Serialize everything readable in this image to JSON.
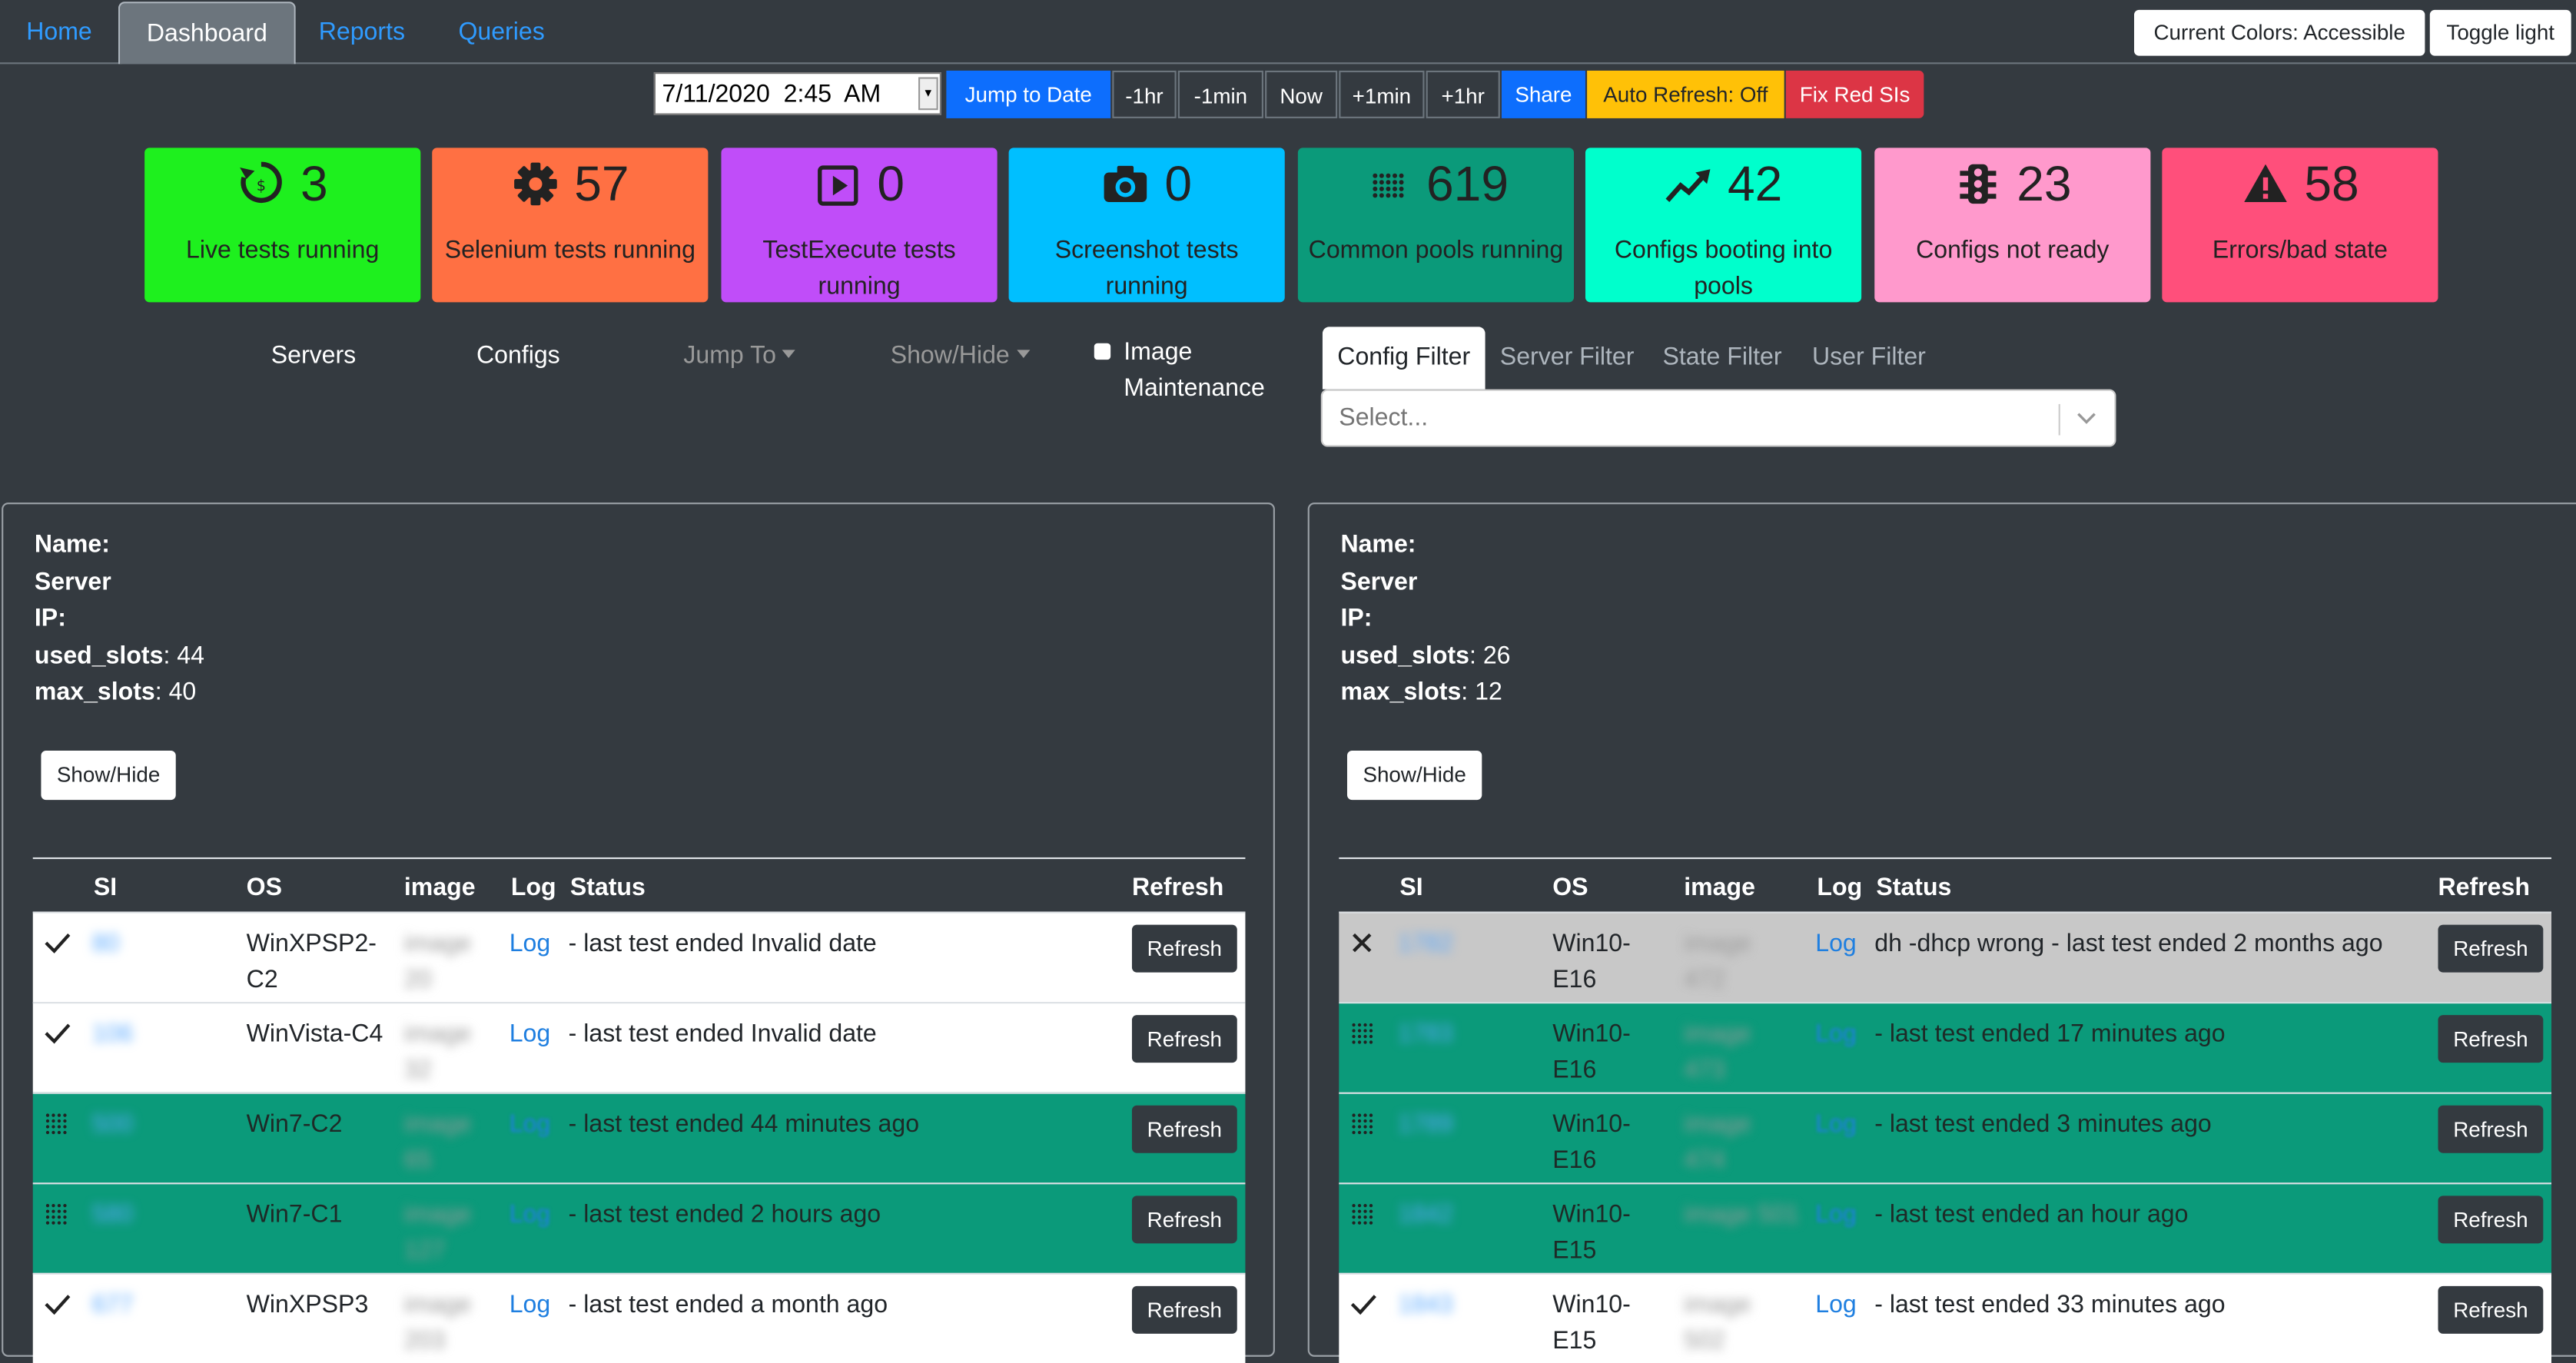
{
  "nav": {
    "home": "Home",
    "dashboard": "Dashboard",
    "reports": "Reports",
    "queries": "Queries",
    "colors_button": "Current Colors: Accessible",
    "toggle_button": "Toggle light"
  },
  "toolbar": {
    "datetime": "7/11/2020  2:45  AM",
    "jump": "Jump to Date",
    "minus_hr": "-1hr",
    "minus_min": "-1min",
    "now": "Now",
    "plus_min": "+1min",
    "plus_hr": "+1hr",
    "share": "Share",
    "auto_refresh": "Auto Refresh: Off",
    "fix_red": "Fix Red SIs"
  },
  "cards": [
    {
      "value": "3",
      "label": "Live tests running",
      "color": "#1ef01e",
      "icon": "live-refresh-icon"
    },
    {
      "value": "57",
      "label": "Selenium tests running",
      "color": "#ff7043",
      "icon": "gear-icon"
    },
    {
      "value": "0",
      "label": "TestExecute tests running",
      "color": "#c04df9",
      "icon": "play-icon"
    },
    {
      "value": "0",
      "label": "Screenshot tests running",
      "color": "#00bfff",
      "icon": "camera-icon"
    },
    {
      "value": "619",
      "label": "Common pools running",
      "color": "#0b9a7a",
      "icon": "dots-grid-icon"
    },
    {
      "value": "42",
      "label": "Configs booting into pools",
      "color": "#00ffcc",
      "icon": "trend-up-icon"
    },
    {
      "value": "23",
      "label": "Configs not ready",
      "color": "#ff99cc",
      "icon": "traffic-light-icon"
    },
    {
      "value": "58",
      "label": "Errors/bad state",
      "color": "#ff4f7b",
      "icon": "warning-icon"
    }
  ],
  "subnav": {
    "servers": "Servers",
    "configs": "Configs",
    "jump_to": "Jump To",
    "show_hide": "Show/Hide",
    "image_maint_1": "Image",
    "image_maint_2": "Maintenance"
  },
  "filters": {
    "config": "Config Filter",
    "server": "Server Filter",
    "state": "State Filter",
    "user": "User Filter",
    "placeholder": "Select..."
  },
  "table_headers": {
    "si": "SI",
    "os": "OS",
    "image": "image",
    "log": "Log",
    "status": "Status",
    "refresh": "Refresh"
  },
  "panels": [
    {
      "name_label": "Name:",
      "server_label": "Server",
      "ip_label": "IP:",
      "used_slots_label": "used_slots",
      "used_slots": ": 44",
      "max_slots_label": "max_slots",
      "max_slots": ": 40",
      "show_hide": "Show/Hide",
      "rows": [
        {
          "state": "check",
          "bg": "white",
          "si": "80",
          "os1": "WinXPSP2-",
          "os2": "C2",
          "img1": "image",
          "img2": "20",
          "log": "Log",
          "status": "- last test ended Invalid date",
          "refresh": "Refresh"
        },
        {
          "state": "check",
          "bg": "white",
          "si": "106",
          "os1": "WinVista-C4",
          "os2": "",
          "img1": "image",
          "img2": "32",
          "log": "Log",
          "status": "- last test ended Invalid date",
          "refresh": "Refresh"
        },
        {
          "state": "pool",
          "bg": "green",
          "si": "500",
          "os1": "Win7-C2",
          "os2": "",
          "img1": "image",
          "img2": "65",
          "log": "Log",
          "status": "- last test ended 44 minutes ago",
          "refresh": "Refresh"
        },
        {
          "state": "pool",
          "bg": "green",
          "si": "580",
          "os1": "Win7-C1",
          "os2": "",
          "img1": "image",
          "img2": "127",
          "log": "Log",
          "status": "- last test ended 2 hours ago",
          "refresh": "Refresh"
        },
        {
          "state": "check",
          "bg": "white",
          "si": "677",
          "os1": "WinXPSP3",
          "os2": "",
          "img1": "image",
          "img2": "203",
          "log": "Log",
          "status": "- last test ended a month ago",
          "refresh": "Refresh"
        }
      ]
    },
    {
      "name_label": "Name:",
      "server_label": "Server",
      "ip_label": "IP:",
      "used_slots_label": "used_slots",
      "used_slots": ": 26",
      "max_slots_label": "max_slots",
      "max_slots": ": 12",
      "show_hide": "Show/Hide",
      "rows": [
        {
          "state": "cross",
          "bg": "gray",
          "si": "1782",
          "os1": "Win10-",
          "os2": "E16",
          "img1": "image",
          "img2": "472",
          "log": "Log",
          "status": "dh -dhcp wrong - last test ended 2 months ago",
          "refresh": "Refresh"
        },
        {
          "state": "pool",
          "bg": "green",
          "si": "1783",
          "os1": "Win10-",
          "os2": "E16",
          "img1": "image",
          "img2": "473",
          "log": "Log",
          "status": "- last test ended 17 minutes ago",
          "refresh": "Refresh"
        },
        {
          "state": "pool",
          "bg": "green",
          "si": "1789",
          "os1": "Win10-",
          "os2": "E16",
          "img1": "image",
          "img2": "474",
          "log": "Log",
          "status": "- last test ended 3 minutes ago",
          "refresh": "Refresh"
        },
        {
          "state": "pool",
          "bg": "green",
          "si": "1842",
          "os1": "Win10-",
          "os2": "E15",
          "img1": "image 501",
          "img2": "",
          "log": "Log",
          "status": "- last test ended an hour ago",
          "refresh": "Refresh"
        },
        {
          "state": "check",
          "bg": "white",
          "si": "1843",
          "os1": "Win10-",
          "os2": "E15",
          "img1": "image",
          "img2": "502",
          "log": "Log",
          "status": "- last test ended 33 minutes ago",
          "refresh": "Refresh"
        }
      ]
    }
  ]
}
